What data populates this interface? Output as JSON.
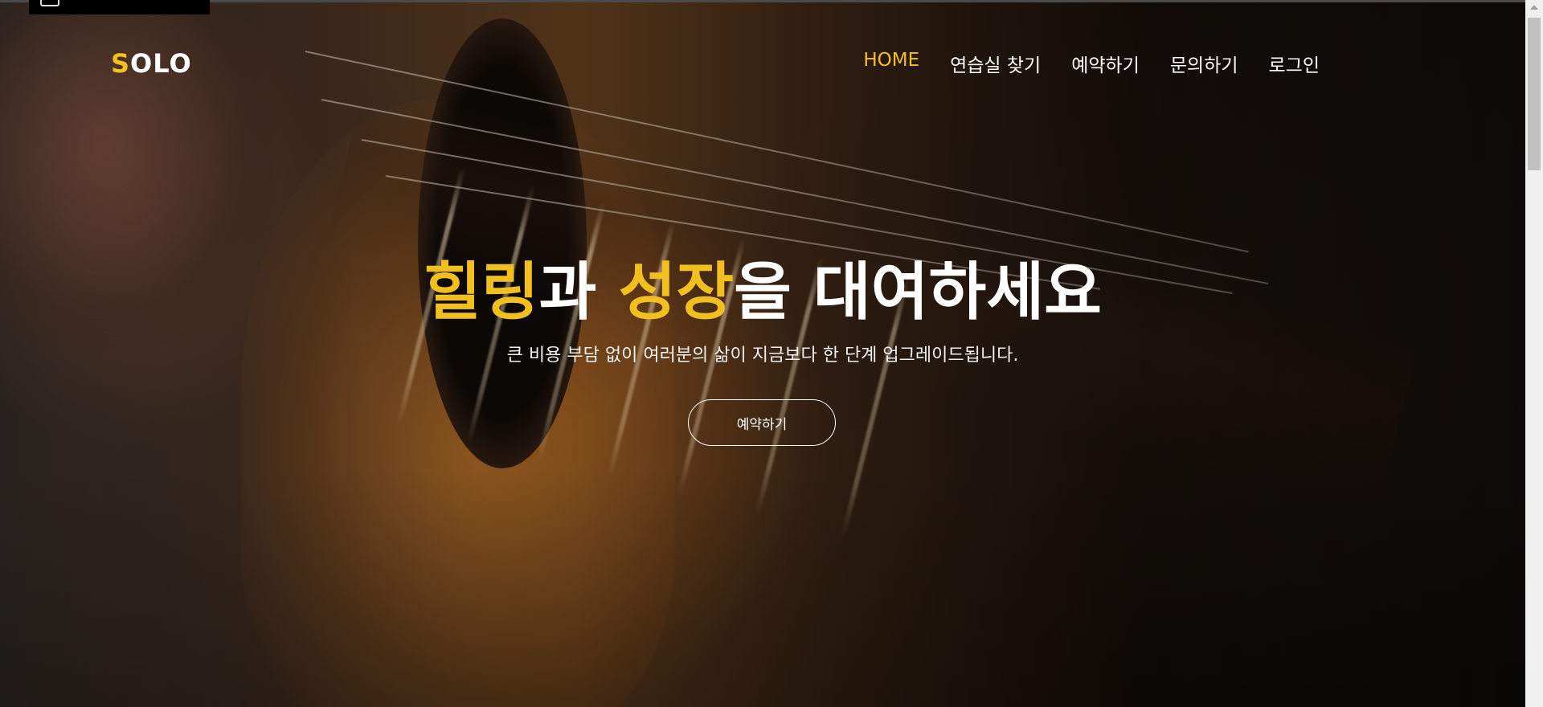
{
  "brand": {
    "logo_first": "S",
    "logo_rest": "OLO",
    "accent_color": "#f2c01e"
  },
  "nav": {
    "items": [
      {
        "label": "HOME",
        "active": true
      },
      {
        "label": "연습실 찾기",
        "active": false
      },
      {
        "label": "예약하기",
        "active": false
      },
      {
        "label": "문의하기",
        "active": false
      },
      {
        "label": "로그인",
        "active": false
      }
    ]
  },
  "hero": {
    "headline_part1": "힐링",
    "headline_part2": "과 ",
    "headline_part3": "성장",
    "headline_part4": "을 대여하세요",
    "subtitle": "큰 비용 부담 없이 여러분의 삶이 지금보다 한 단계 업그레이드됩니다.",
    "cta_label": "예약하기"
  }
}
